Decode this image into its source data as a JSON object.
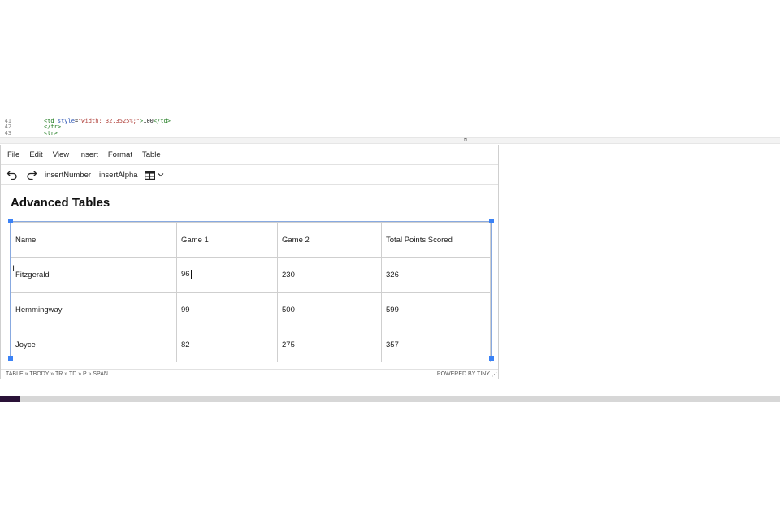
{
  "code": {
    "lines": [
      {
        "num": "41",
        "tag_open": "<td ",
        "attr": "style",
        "eq": "=",
        "str": "\"width: 32.3525%;\"",
        "after": ">",
        "text": "100",
        "tag_close": "</td>"
      },
      {
        "num": "42",
        "plain": "</tr>"
      },
      {
        "num": "43",
        "plain": "<tr>"
      }
    ]
  },
  "menu": [
    "File",
    "Edit",
    "View",
    "Insert",
    "Format",
    "Table"
  ],
  "toolbar": {
    "undo_icon": "undo-icon",
    "redo_icon": "redo-icon",
    "insert_number": "insertNumber",
    "insert_alpha": "insertAlpha",
    "table_icon": "table-icon"
  },
  "content": {
    "heading": "Advanced Tables",
    "table": {
      "rows": [
        [
          "Name",
          "Game 1",
          "Game 2",
          "Total Points Scored"
        ],
        [
          "Fitzgerald",
          "96",
          "230",
          "326"
        ],
        [
          "Hemmingway",
          "99",
          "500",
          "599"
        ],
        [
          "Joyce",
          "82",
          "275",
          "357"
        ]
      ]
    }
  },
  "status": {
    "path": "TABLE » TBODY » TR » TD » P » SPAN",
    "brand": "POWERED BY TINY"
  },
  "colors": {
    "selection_border": "#88a9e0",
    "handle": "#3b82f6",
    "bottom_accent": "#2a1238"
  }
}
